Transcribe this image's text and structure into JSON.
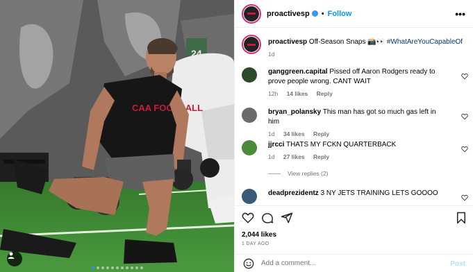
{
  "post": {
    "username": "proactivesp",
    "follow_label": "Follow",
    "separator": "•",
    "more_icon": "•••",
    "caption_username": "proactivesp",
    "caption_text": "Off-Season Snaps 📸👀",
    "caption_hashtag": "#WhatAreYouCapableOf",
    "caption_time": "1d",
    "likes": "2,044 likes",
    "time_ago": "1 DAY AGO",
    "add_comment_placeholder": "Add a comment...",
    "post_label": "Post",
    "photo_shirt_text": "CAA FOOTBALL"
  },
  "comments": [
    {
      "username": "ganggreen.capital",
      "text": "Pissed off Aaron Rodgers ready to prove people wrong. CANT WAIT",
      "time": "12h",
      "likes": "14 likes",
      "reply": "Reply",
      "avatar_color": "#2d4a2d"
    },
    {
      "username": "bryan_polansky",
      "text": "This man has got so much gas left in him",
      "time": "1d",
      "likes": "34 likes",
      "reply": "Reply",
      "avatar_color": "#6b6b6b"
    },
    {
      "username": "jjrcci",
      "text": "THATS MY FCKN QUARTERBACK",
      "time": "1d",
      "likes": "27 likes",
      "reply": "Reply",
      "avatar_color": "#4a8a3a",
      "view_replies": "View replies (2)"
    },
    {
      "username": "deadprezidentz",
      "text": "3 NY JETS TRAINING LETS GOOOO",
      "avatar_color": "#3a5a7a"
    }
  ],
  "colors": {
    "accent": "#0095f6",
    "verified": "#3897f0",
    "meta": "#737373"
  }
}
